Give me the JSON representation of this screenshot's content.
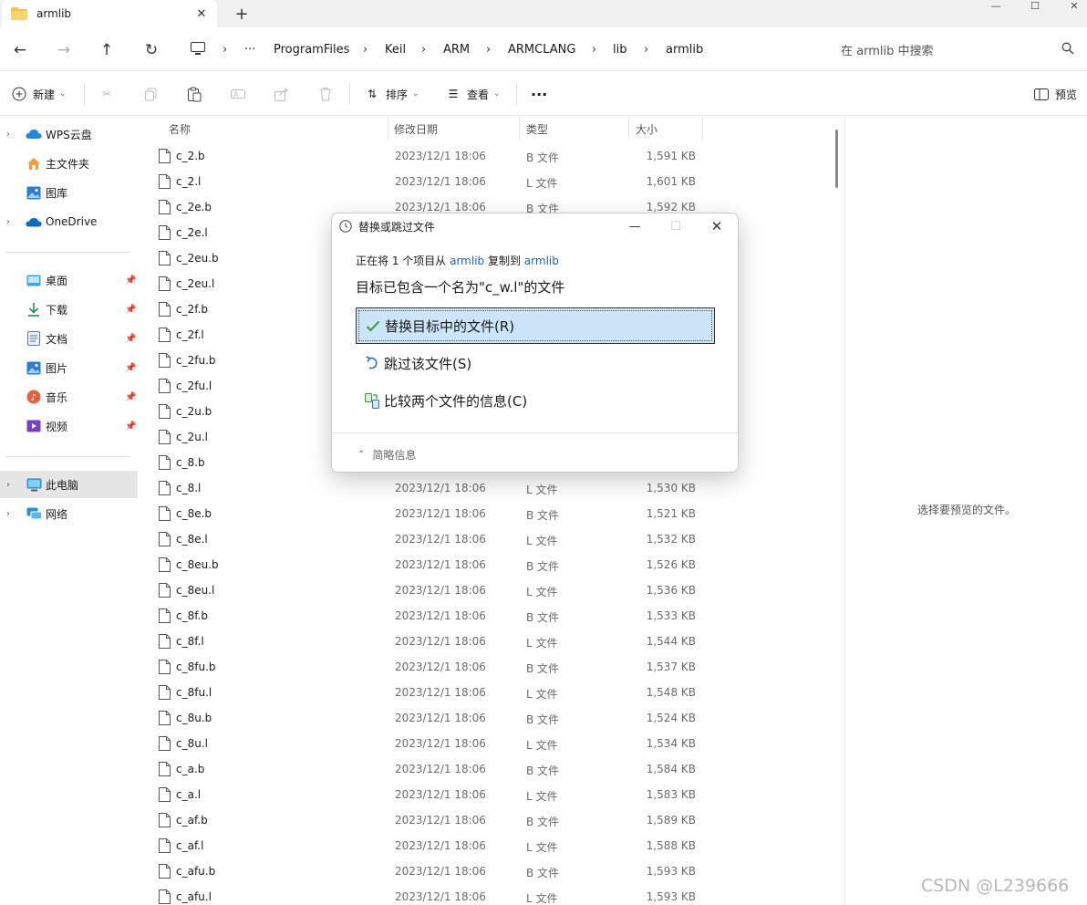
{
  "tab": {
    "title": "armlib",
    "folder_color": "#f2c14e"
  },
  "window_controls": {
    "minimize": "—",
    "maximize": "☐",
    "close": "✕"
  },
  "nav": {
    "back": "←",
    "forward": "→",
    "up": "↑",
    "refresh": "↻"
  },
  "address": {
    "more": "···",
    "crumbs": [
      "ProgramFiles",
      "Keil",
      "ARM",
      "ARMCLANG",
      "lib",
      "armlib"
    ]
  },
  "search": {
    "placeholder": "在 armlib 中搜索"
  },
  "toolbar": {
    "new_label": "新建",
    "sort_label": "排序",
    "view_label": "查看",
    "more": "···",
    "preview_label": "预览"
  },
  "sidebar": {
    "items": [
      {
        "label": "WPS云盘",
        "icon": "cloud-icon"
      },
      {
        "label": "主文件夹",
        "icon": "home-icon"
      },
      {
        "label": "图库",
        "icon": "gallery-icon"
      },
      {
        "label": "OneDrive",
        "icon": "onedrive-icon"
      },
      {
        "label": "桌面",
        "icon": "desktop-icon"
      },
      {
        "label": "下载",
        "icon": "download-icon"
      },
      {
        "label": "文档",
        "icon": "documents-icon"
      },
      {
        "label": "图片",
        "icon": "pictures-icon"
      },
      {
        "label": "音乐",
        "icon": "music-icon"
      },
      {
        "label": "视频",
        "icon": "videos-icon"
      },
      {
        "label": "此电脑",
        "icon": "this-pc-icon"
      },
      {
        "label": "网络",
        "icon": "network-icon"
      }
    ]
  },
  "columns": {
    "name": "名称",
    "date": "修改日期",
    "type": "类型",
    "size": "大小"
  },
  "files": [
    {
      "name": "c_2.b",
      "date": "2023/12/1 18:06",
      "type": "B 文件",
      "size": "1,591 KB"
    },
    {
      "name": "c_2.l",
      "date": "2023/12/1 18:06",
      "type": "L 文件",
      "size": "1,601 KB"
    },
    {
      "name": "c_2e.b",
      "date": "2023/12/1 18:06",
      "type": "B 文件",
      "size": "1,592 KB"
    },
    {
      "name": "c_2e.l",
      "date": "",
      "type": "",
      "size": ""
    },
    {
      "name": "c_2eu.b",
      "date": "",
      "type": "",
      "size": ""
    },
    {
      "name": "c_2eu.l",
      "date": "",
      "type": "",
      "size": ""
    },
    {
      "name": "c_2f.b",
      "date": "",
      "type": "",
      "size": ""
    },
    {
      "name": "c_2f.l",
      "date": "",
      "type": "",
      "size": ""
    },
    {
      "name": "c_2fu.b",
      "date": "",
      "type": "",
      "size": ""
    },
    {
      "name": "c_2fu.l",
      "date": "",
      "type": "",
      "size": ""
    },
    {
      "name": "c_2u.b",
      "date": "",
      "type": "",
      "size": ""
    },
    {
      "name": "c_2u.l",
      "date": "",
      "type": "",
      "size": ""
    },
    {
      "name": "c_8.b",
      "date": "",
      "type": "",
      "size": ""
    },
    {
      "name": "c_8.l",
      "date": "2023/12/1 18:06",
      "type": "L 文件",
      "size": "1,530 KB"
    },
    {
      "name": "c_8e.b",
      "date": "2023/12/1 18:06",
      "type": "B 文件",
      "size": "1,521 KB"
    },
    {
      "name": "c_8e.l",
      "date": "2023/12/1 18:06",
      "type": "L 文件",
      "size": "1,532 KB"
    },
    {
      "name": "c_8eu.b",
      "date": "2023/12/1 18:06",
      "type": "B 文件",
      "size": "1,526 KB"
    },
    {
      "name": "c_8eu.l",
      "date": "2023/12/1 18:06",
      "type": "L 文件",
      "size": "1,536 KB"
    },
    {
      "name": "c_8f.b",
      "date": "2023/12/1 18:06",
      "type": "B 文件",
      "size": "1,533 KB"
    },
    {
      "name": "c_8f.l",
      "date": "2023/12/1 18:06",
      "type": "L 文件",
      "size": "1,544 KB"
    },
    {
      "name": "c_8fu.b",
      "date": "2023/12/1 18:06",
      "type": "B 文件",
      "size": "1,537 KB"
    },
    {
      "name": "c_8fu.l",
      "date": "2023/12/1 18:06",
      "type": "L 文件",
      "size": "1,548 KB"
    },
    {
      "name": "c_8u.b",
      "date": "2023/12/1 18:06",
      "type": "B 文件",
      "size": "1,524 KB"
    },
    {
      "name": "c_8u.l",
      "date": "2023/12/1 18:06",
      "type": "L 文件",
      "size": "1,534 KB"
    },
    {
      "name": "c_a.b",
      "date": "2023/12/1 18:06",
      "type": "B 文件",
      "size": "1,584 KB"
    },
    {
      "name": "c_a.l",
      "date": "2023/12/1 18:06",
      "type": "L 文件",
      "size": "1,583 KB"
    },
    {
      "name": "c_af.b",
      "date": "2023/12/1 18:06",
      "type": "B 文件",
      "size": "1,589 KB"
    },
    {
      "name": "c_af.l",
      "date": "2023/12/1 18:06",
      "type": "L 文件",
      "size": "1,588 KB"
    },
    {
      "name": "c_afu.b",
      "date": "2023/12/1 18:06",
      "type": "B 文件",
      "size": "1,593 KB"
    },
    {
      "name": "c_afu.l",
      "date": "2023/12/1 18:06",
      "type": "L 文件",
      "size": "1,593 KB"
    }
  ],
  "preview_pane": {
    "message": "选择要预览的文件。"
  },
  "dialog": {
    "title": "替换或跳过文件",
    "progress_prefix": "正在将 1 个项目从 ",
    "source": "armlib",
    "progress_middle": " 复制到 ",
    "destination": "armlib",
    "message": "目标已包含一个名为\"c_w.l\"的文件",
    "option_replace": "替换目标中的文件(R)",
    "option_skip": "跳过该文件(S)",
    "option_compare": "比较两个文件的信息(C)",
    "less_details": "简略信息"
  },
  "watermark": "CSDN @L239666",
  "colors": {
    "accent": "#1a63b8",
    "selected_option_bg": "#cce4f7",
    "check_green": "#3a9a3a"
  }
}
